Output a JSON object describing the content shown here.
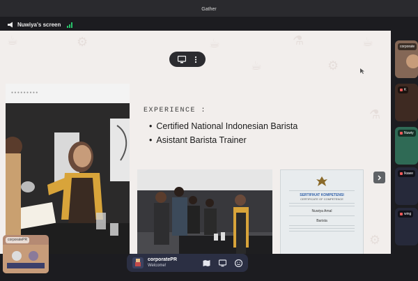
{
  "window": {
    "title": "Gather"
  },
  "share": {
    "label": "Nuwiya's screen"
  },
  "slide": {
    "experience_title": "EXPERIENCE :",
    "bullets": [
      "Certified National Indonesian Barista",
      "Asistant Barista Trainer"
    ],
    "certificate": {
      "title": "SERTIFIKAT KOMPETENSI",
      "subtitle": "CERTIFICATE OF COMPETENCE",
      "name": "Nuwiya Amal",
      "role": "Barista"
    }
  },
  "participants": [
    {
      "name": "corporate"
    },
    {
      "name": "K"
    },
    {
      "name": "Nuwiy"
    },
    {
      "name": "Ikawe"
    },
    {
      "name": "wing"
    }
  ],
  "self": {
    "label": "corporatePR"
  },
  "bottom_bar": {
    "name": "corporatePR",
    "status": "Welcome!"
  },
  "colors": {
    "accent_green": "#27c46a",
    "bar_bg": "#2b2f43",
    "slide_bg": "#f2eeec"
  }
}
